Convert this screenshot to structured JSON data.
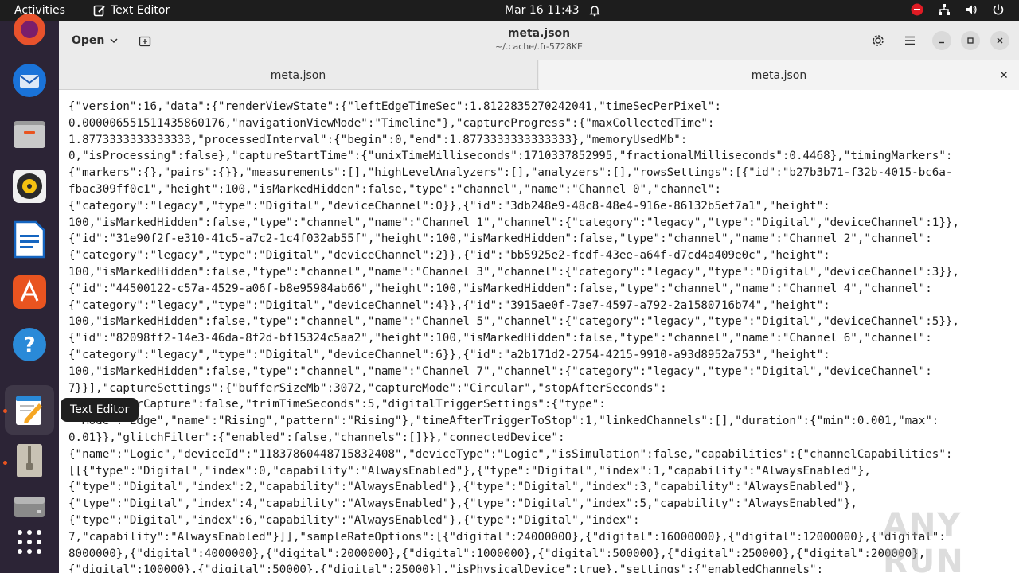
{
  "topbar": {
    "activities": "Activities",
    "app_name": "Text Editor",
    "clock": "Mar 16  11:43"
  },
  "dock": {
    "tooltip": "Text Editor",
    "items": [
      "firefox",
      "thunderbird",
      "files",
      "rhythmbox",
      "libreoffice-writer",
      "app-center",
      "help",
      "text-editor",
      "archive",
      "disk",
      "show-apps"
    ]
  },
  "window": {
    "open_label": "Open",
    "title": "meta.json",
    "subtitle": "~/.cache/.fr-5728KE",
    "tabs": [
      {
        "label": "meta.json"
      },
      {
        "label": "meta.json"
      }
    ]
  },
  "editor": {
    "lines": [
      "{\"version\":16,\"data\":{\"renderViewState\":{\"leftEdgeTimeSec\":1.8122835270242041,\"timeSecPerPixel\":",
      "0.000006551511435860176,\"navigationViewMode\":\"Timeline\"},\"captureProgress\":{\"maxCollectedTime\":",
      "1.8773333333333333,\"processedInterval\":{\"begin\":0,\"end\":1.8773333333333333},\"memoryUsedMb\":",
      "0,\"isProcessing\":false},\"captureStartTime\":{\"unixTimeMilliseconds\":1710337852995,\"fractionalMilliseconds\":0.4468},\"timingMarkers\":",
      "{\"markers\":{},\"pairs\":{}},\"measurements\":[],\"highLevelAnalyzers\":[],\"analyzers\":[],\"rowsSettings\":[{\"id\":\"b27b3b71-f32b-4015-bc6a-",
      "fbac309ff0c1\",\"height\":100,\"isMarkedHidden\":false,\"type\":\"channel\",\"name\":\"Channel 0\",\"channel\":",
      "{\"category\":\"legacy\",\"type\":\"Digital\",\"deviceChannel\":0}},{\"id\":\"3db248e9-48c8-48e4-916e-86132b5ef7a1\",\"height\":",
      "100,\"isMarkedHidden\":false,\"type\":\"channel\",\"name\":\"Channel 1\",\"channel\":{\"category\":\"legacy\",\"type\":\"Digital\",\"deviceChannel\":1}},",
      "{\"id\":\"31e90f2f-e310-41c5-a7c2-1c4f032ab55f\",\"height\":100,\"isMarkedHidden\":false,\"type\":\"channel\",\"name\":\"Channel 2\",\"channel\":",
      "{\"category\":\"legacy\",\"type\":\"Digital\",\"deviceChannel\":2}},{\"id\":\"bb5925e2-fcdf-43ee-a64f-d7cd4a409e0c\",\"height\":",
      "100,\"isMarkedHidden\":false,\"type\":\"channel\",\"name\":\"Channel 3\",\"channel\":{\"category\":\"legacy\",\"type\":\"Digital\",\"deviceChannel\":3}},",
      "{\"id\":\"44500122-c57a-4529-a06f-b8e95984ab66\",\"height\":100,\"isMarkedHidden\":false,\"type\":\"channel\",\"name\":\"Channel 4\",\"channel\":",
      "{\"category\":\"legacy\",\"type\":\"Digital\",\"deviceChannel\":4}},{\"id\":\"3915ae0f-7ae7-4597-a792-2a1580716b74\",\"height\":",
      "100,\"isMarkedHidden\":false,\"type\":\"channel\",\"name\":\"Channel 5\",\"channel\":{\"category\":\"legacy\",\"type\":\"Digital\",\"deviceChannel\":5}},",
      "{\"id\":\"82098ff2-14e3-46da-8f2d-bf15324c5aa2\",\"height\":100,\"isMarkedHidden\":false,\"type\":\"channel\",\"name\":\"Channel 6\",\"channel\":",
      "{\"category\":\"legacy\",\"type\":\"Digital\",\"deviceChannel\":6}},{\"id\":\"a2b171d2-2754-4215-9910-a93d8952a753\",\"height\":",
      "100,\"isMarkedHidden\":false,\"type\":\"channel\",\"name\":\"Channel 7\",\"channel\":{\"category\":\"legacy\",\"type\":\"Digital\",\"deviceChannel\":",
      "7}}],\"captureSettings\":{\"bufferSizeMb\":3072,\"captureMode\":\"Circular\",\"stopAfterSeconds\":",
      "       fterCapture\":false,\"trimTimeSeconds\":5,\"digitalTriggerSettings\":{\"type\":",
      "  Mode :\"Edge\",\"name\":\"Rising\",\"pattern\":\"Rising\"},\"timeAfterTriggerToStop\":1,\"linkedChannels\":[],\"duration\":{\"min\":0.001,\"max\":",
      "0.01}},\"glitchFilter\":{\"enabled\":false,\"channels\":[]}},\"connectedDevice\":",
      "{\"name\":\"Logic\",\"deviceId\":\"11837860448715832408\",\"deviceType\":\"Logic\",\"isSimulation\":false,\"capabilities\":{\"channelCapabilities\":",
      "[[{\"type\":\"Digital\",\"index\":0,\"capability\":\"AlwaysEnabled\"},{\"type\":\"Digital\",\"index\":1,\"capability\":\"AlwaysEnabled\"},",
      "{\"type\":\"Digital\",\"index\":2,\"capability\":\"AlwaysEnabled\"},{\"type\":\"Digital\",\"index\":3,\"capability\":\"AlwaysEnabled\"},",
      "{\"type\":\"Digital\",\"index\":4,\"capability\":\"AlwaysEnabled\"},{\"type\":\"Digital\",\"index\":5,\"capability\":\"AlwaysEnabled\"},",
      "{\"type\":\"Digital\",\"index\":6,\"capability\":\"AlwaysEnabled\"},{\"type\":\"Digital\",\"index\":",
      "7,\"capability\":\"AlwaysEnabled\"}]],\"sampleRateOptions\":[{\"digital\":24000000},{\"digital\":16000000},{\"digital\":12000000},{\"digital\":",
      "8000000},{\"digital\":4000000},{\"digital\":2000000},{\"digital\":1000000},{\"digital\":500000},{\"digital\":250000},{\"digital\":200000},",
      "{\"digital\":100000},{\"digital\":50000},{\"digital\":25000}],\"isPhysicalDevice\":true},\"settings\":{\"enabledChannels\":"
    ]
  },
  "watermark": "ANY RUN"
}
